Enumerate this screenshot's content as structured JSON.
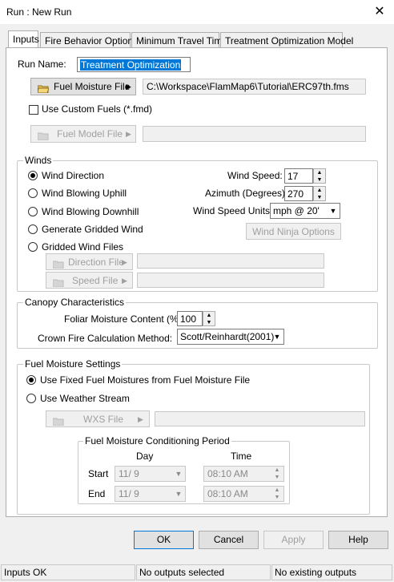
{
  "window": {
    "title": "Run : New Run",
    "close_glyph": "✕"
  },
  "tabs": [
    "Inputs",
    "Fire Behavior Options",
    "Minimum Travel Time",
    "Treatment Optimization Model"
  ],
  "inputs": {
    "run_name_label": "Run Name:",
    "run_name_value": "Treatment Optimization",
    "fuel_moisture_button": "Fuel Moisture File",
    "fuel_moisture_path": "C:\\Workspace\\FlamMap6\\Tutorial\\ERC97th.fms",
    "use_custom_fuels_label": "Use Custom Fuels (*.fmd)",
    "fuel_model_button": "Fuel Model File",
    "fuel_model_path": ""
  },
  "winds": {
    "group_title": "Winds",
    "options": [
      "Wind Direction",
      "Wind Blowing Uphill",
      "Wind Blowing Downhill",
      "Generate Gridded Wind",
      "Gridded Wind Files"
    ],
    "selected": 0,
    "wind_speed_label": "Wind Speed:",
    "wind_speed_value": "17",
    "azimuth_label": "Azimuth (Degrees):",
    "azimuth_value": "270",
    "units_label": "Wind Speed Units:",
    "units_value": "mph @ 20'",
    "ninja_button": "Wind Ninja Options",
    "direction_file_button": "Direction File",
    "speed_file_button": "Speed File"
  },
  "canopy": {
    "group_title": "Canopy Characteristics",
    "foliar_label": "Foliar Moisture Content (%):",
    "foliar_value": "100",
    "crown_label": "Crown Fire Calculation Method:",
    "crown_value": "Scott/Reinhardt(2001)"
  },
  "fuel_moisture": {
    "group_title": "Fuel Moisture Settings",
    "options": [
      "Use Fixed Fuel Moistures from Fuel Moisture File",
      "Use Weather Stream"
    ],
    "selected": 0,
    "wxs_button": "WXS File",
    "conditioning": {
      "title": "Fuel Moisture Conditioning Period",
      "day_header": "Day",
      "time_header": "Time",
      "start_label": "Start",
      "end_label": "End",
      "start_day": "11/ 9",
      "start_time": "08:10 AM",
      "end_day": "11/ 9",
      "end_time": "08:10 AM"
    }
  },
  "footer": {
    "ok": "OK",
    "cancel": "Cancel",
    "apply": "Apply",
    "help": "Help"
  },
  "status": [
    "Inputs OK",
    "No outputs selected",
    "No existing outputs"
  ]
}
